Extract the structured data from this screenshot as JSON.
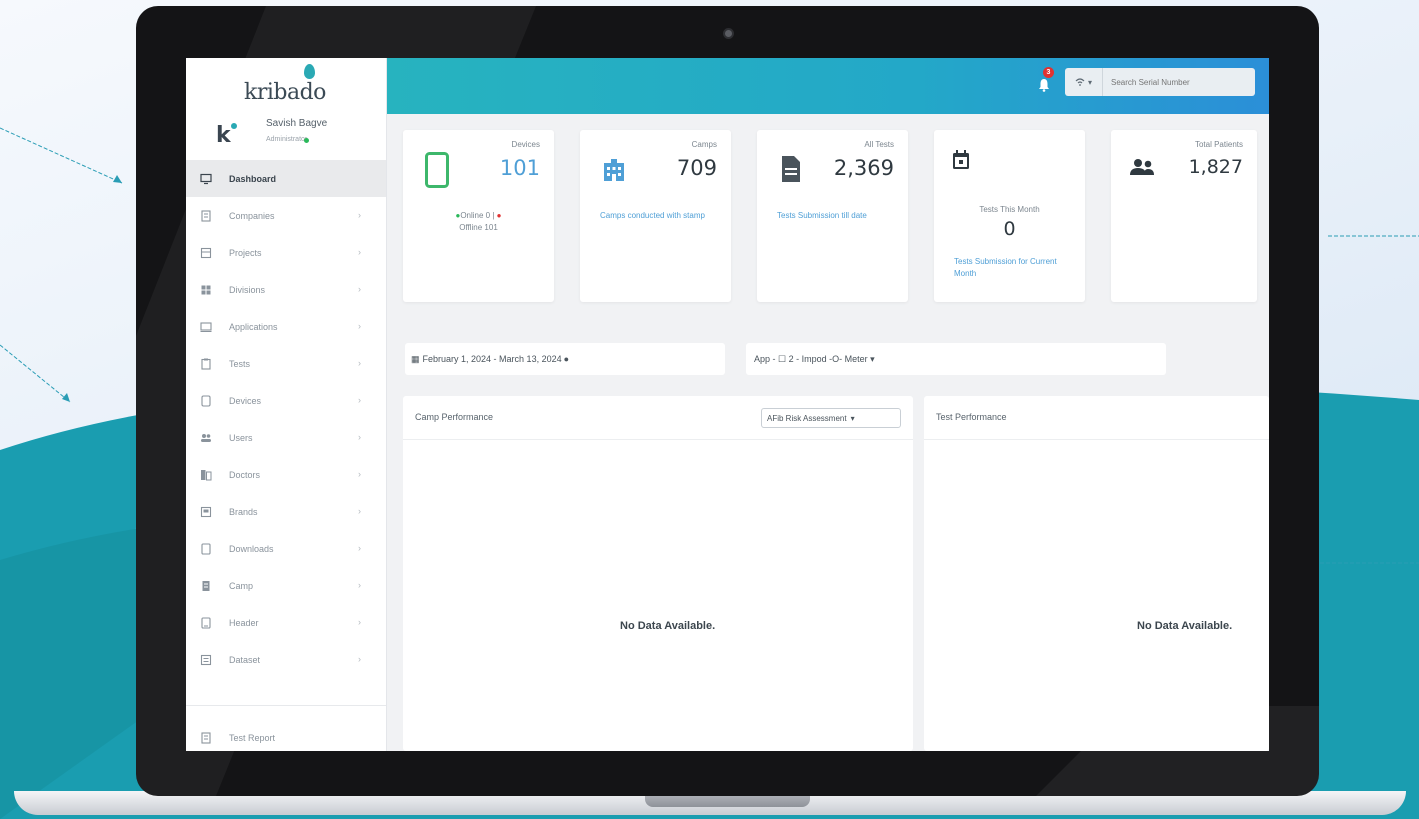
{
  "brand": {
    "name": "kribado",
    "accent": "#2aa9b4",
    "topbar_start": "#27b3bf",
    "topbar_end": "#2b8fd8"
  },
  "user": {
    "initial": "k",
    "name": "Savish Bagve",
    "role": "Administrator"
  },
  "sidebar": {
    "items": [
      {
        "label": "Dashboard",
        "icon": "monitor-icon",
        "active": true
      },
      {
        "label": "Companies",
        "icon": "building-icon"
      },
      {
        "label": "Projects",
        "icon": "folder-icon"
      },
      {
        "label": "Divisions",
        "icon": "grid-icon"
      },
      {
        "label": "Applications",
        "icon": "window-icon"
      },
      {
        "label": "Tests",
        "icon": "clipboard-icon"
      },
      {
        "label": "Devices",
        "icon": "tablet-icon"
      },
      {
        "label": "Users",
        "icon": "users-icon"
      },
      {
        "label": "Doctors",
        "icon": "stethoscope-icon"
      },
      {
        "label": "Brands",
        "icon": "tag-icon"
      },
      {
        "label": "Downloads",
        "icon": "download-icon"
      },
      {
        "label": "Camp",
        "icon": "tent-icon"
      },
      {
        "label": "Header",
        "icon": "header-icon"
      },
      {
        "label": "Dataset",
        "icon": "database-icon"
      }
    ],
    "footer_item": {
      "label": "Test Report",
      "icon": "report-icon"
    }
  },
  "topbar": {
    "notifications": "3",
    "search_prefix": "▾",
    "search_placeholder": "Search Serial Number"
  },
  "stats": {
    "devices": {
      "label": "Devices",
      "value": "101",
      "online": "Online 0",
      "offline": "Offline 101",
      "separator": "|"
    },
    "camps": {
      "label": "Camps",
      "value": "709",
      "link": "Camps conducted with stamp"
    },
    "all_tests": {
      "label": "All Tests",
      "value": "2,369",
      "link": "Tests Submission till date"
    },
    "tests_month": {
      "label": "Tests This Month",
      "value": "0",
      "link": "Tests Submission for Current Month"
    },
    "patients": {
      "label": "Total Patients",
      "value": "1,827"
    }
  },
  "filters": {
    "date_range": "February 1, 2024 - March 13, 2024",
    "app": "App - ☐ 2 - Impod -O- Meter ▾"
  },
  "panels": {
    "camp": {
      "title": "Camp Performance",
      "select": "AFib Risk Assessment",
      "empty": "No Data Available."
    },
    "test": {
      "title": "Test Performance",
      "empty": "No Data Available."
    }
  }
}
